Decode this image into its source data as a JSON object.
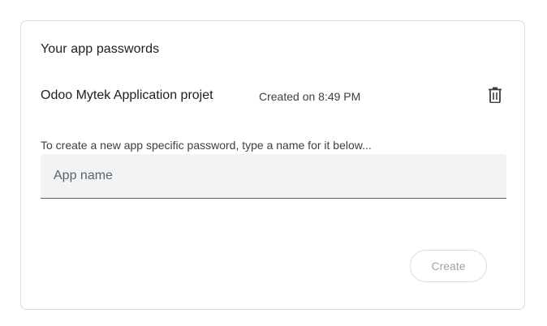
{
  "section": {
    "title": "Your app passwords"
  },
  "passwords": [
    {
      "name": "Odoo Mytek Application projet",
      "created": "Created on 8:49 PM",
      "delete_icon": "trash-icon"
    }
  ],
  "create": {
    "helper_text": "To create a new app specific password, type a name for it below...",
    "input_placeholder": "App name",
    "input_value": "",
    "button_label": "Create",
    "button_state": "disabled"
  },
  "colors": {
    "text_primary": "#202124",
    "text_secondary": "#3c4043",
    "field_bg": "#f1f3f4",
    "border": "#dadce0",
    "disabled_text": "#a0a3a8"
  }
}
